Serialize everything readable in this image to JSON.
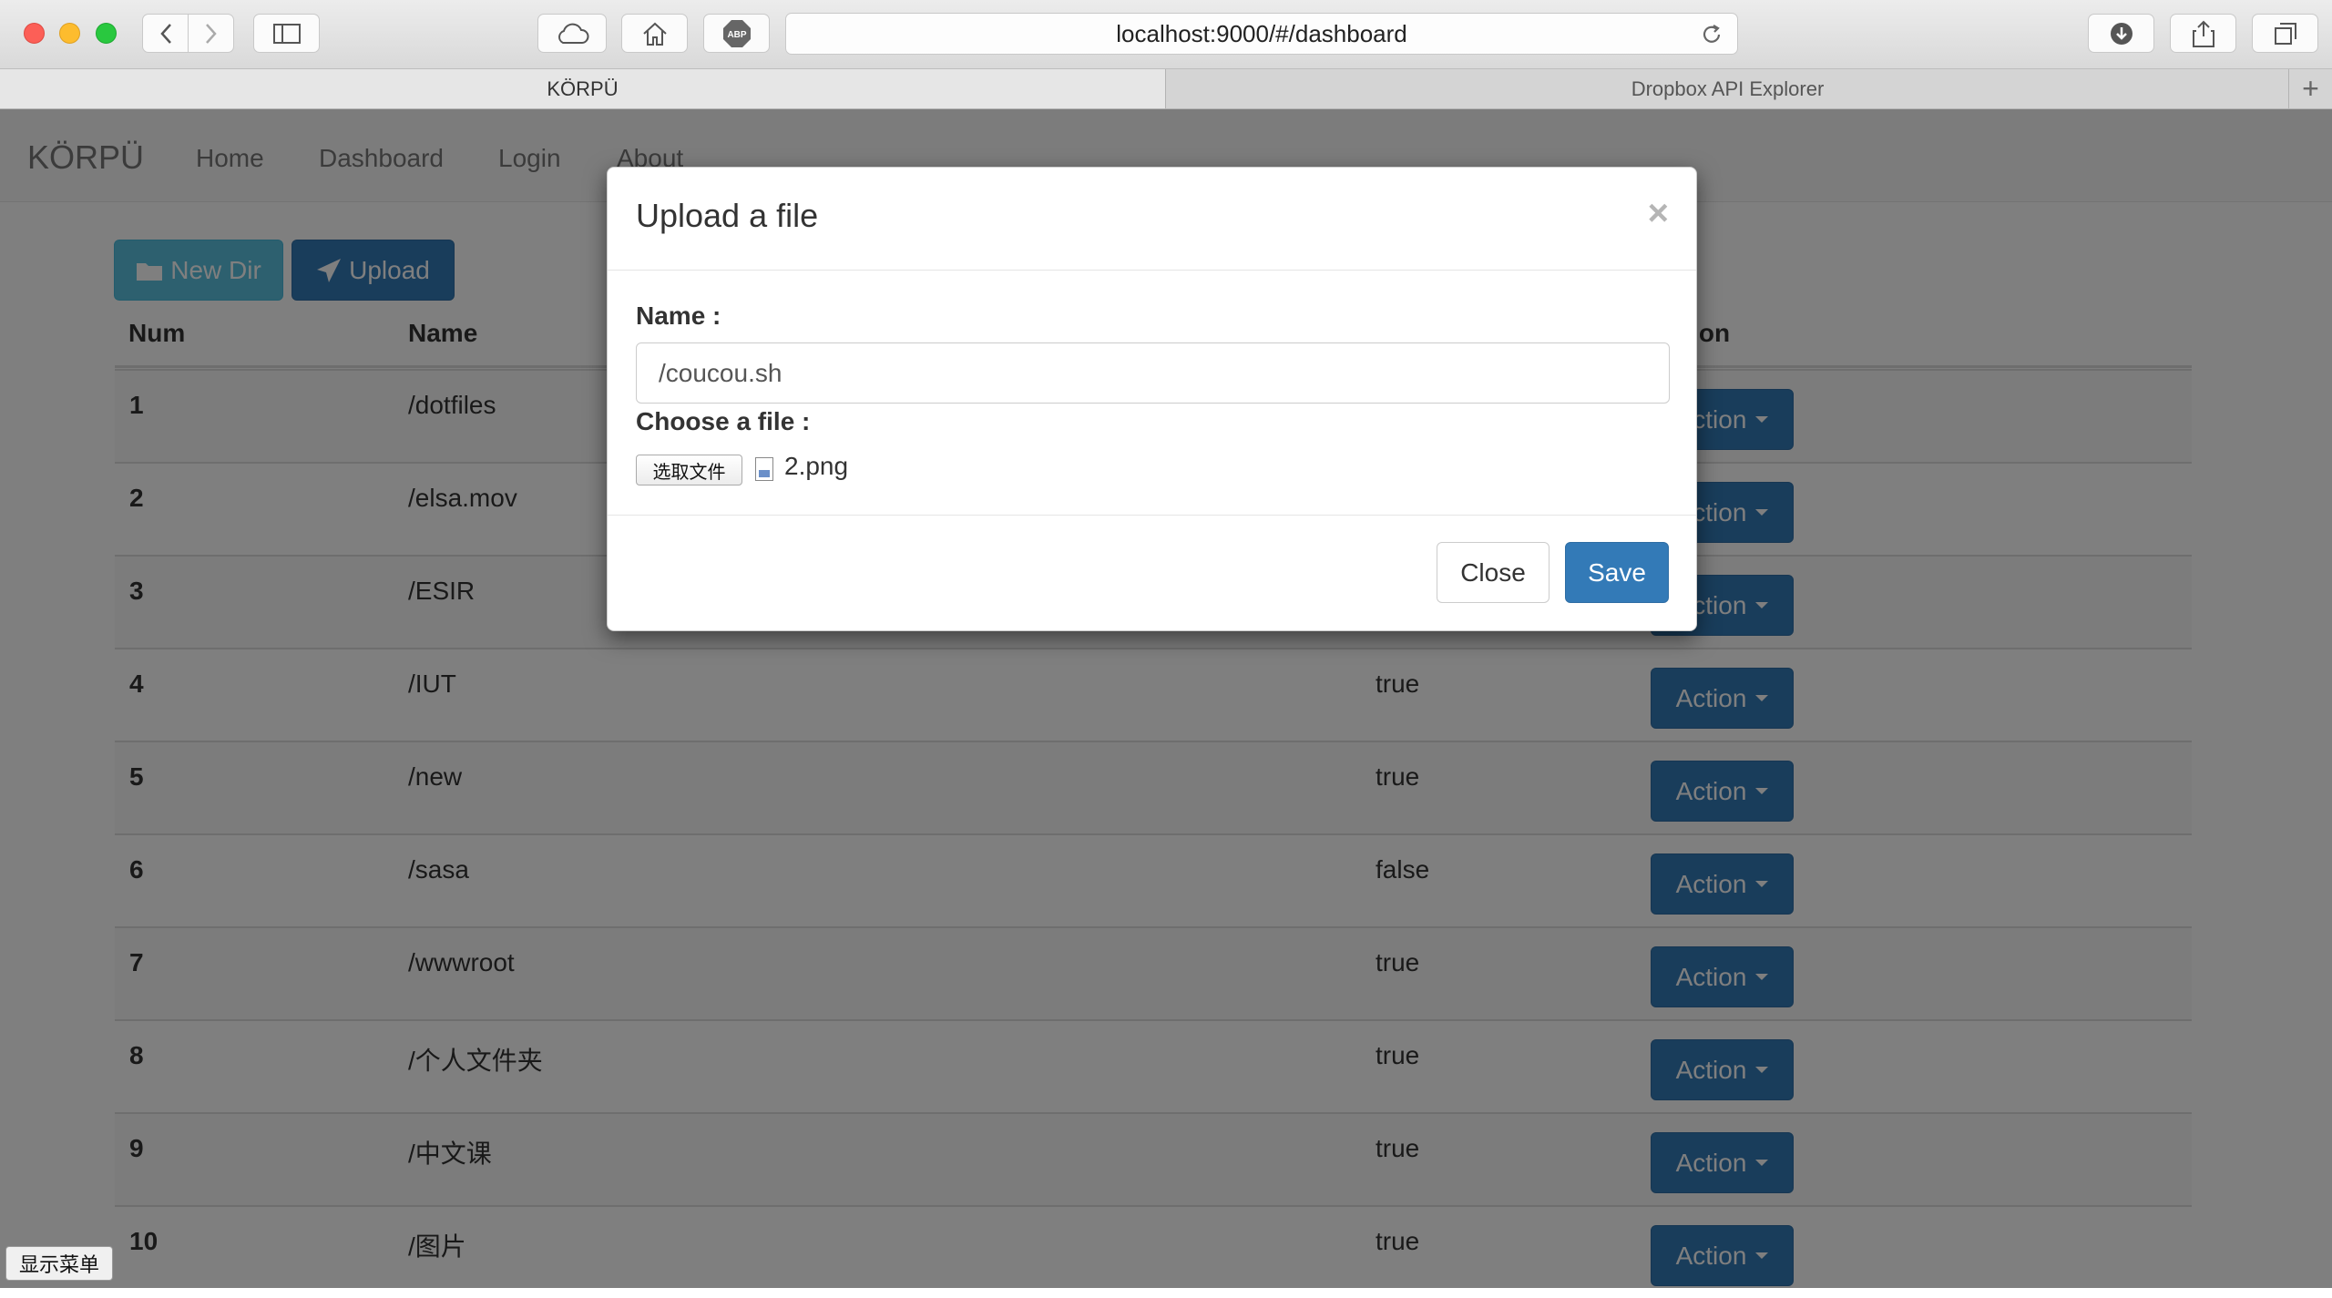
{
  "browser": {
    "url": "localhost:9000/#/dashboard",
    "tabs": [
      {
        "label": "KÖRPÜ"
      },
      {
        "label": "Dropbox API Explorer"
      }
    ],
    "new_tab_label": "+"
  },
  "app": {
    "brand": "KÖRPÜ",
    "nav": [
      {
        "label": "Home"
      },
      {
        "label": "Dashboard"
      },
      {
        "label": "Login"
      },
      {
        "label": "About"
      }
    ],
    "toolbar": {
      "new_dir_label": "New Dir",
      "upload_label": "Upload"
    },
    "table": {
      "headers": {
        "num": "Num",
        "name": "Name",
        "action": "Action"
      },
      "rows": [
        {
          "num": "1",
          "name": "/dotfiles",
          "is_dir": "",
          "action": "Action"
        },
        {
          "num": "2",
          "name": "/elsa.mov",
          "is_dir": "",
          "action": "Action"
        },
        {
          "num": "3",
          "name": "/ESIR",
          "is_dir": "",
          "action": "Action"
        },
        {
          "num": "4",
          "name": "/IUT",
          "is_dir": "true",
          "action": "Action"
        },
        {
          "num": "5",
          "name": "/new",
          "is_dir": "true",
          "action": "Action"
        },
        {
          "num": "6",
          "name": "/sasa",
          "is_dir": "false",
          "action": "Action"
        },
        {
          "num": "7",
          "name": "/wwwroot",
          "is_dir": "true",
          "action": "Action"
        },
        {
          "num": "8",
          "name": "/个人文件夹",
          "is_dir": "true",
          "action": "Action"
        },
        {
          "num": "9",
          "name": "/中文课",
          "is_dir": "true",
          "action": "Action"
        },
        {
          "num": "10",
          "name": "/图片",
          "is_dir": "true",
          "action": "Action"
        }
      ]
    }
  },
  "modal": {
    "title": "Upload a file",
    "close_x": "×",
    "name_label": "Name :",
    "name_value": "/coucou.sh",
    "file_label": "Choose a file :",
    "file_button": "选取文件",
    "file_name": "2.png",
    "close_button": "Close",
    "save_button": "Save"
  },
  "show_menu_label": "显示菜单",
  "colors": {
    "primary": "#337ab7",
    "info": "#5bc0de",
    "backdrop": "rgba(0,0,0,0.5)"
  }
}
